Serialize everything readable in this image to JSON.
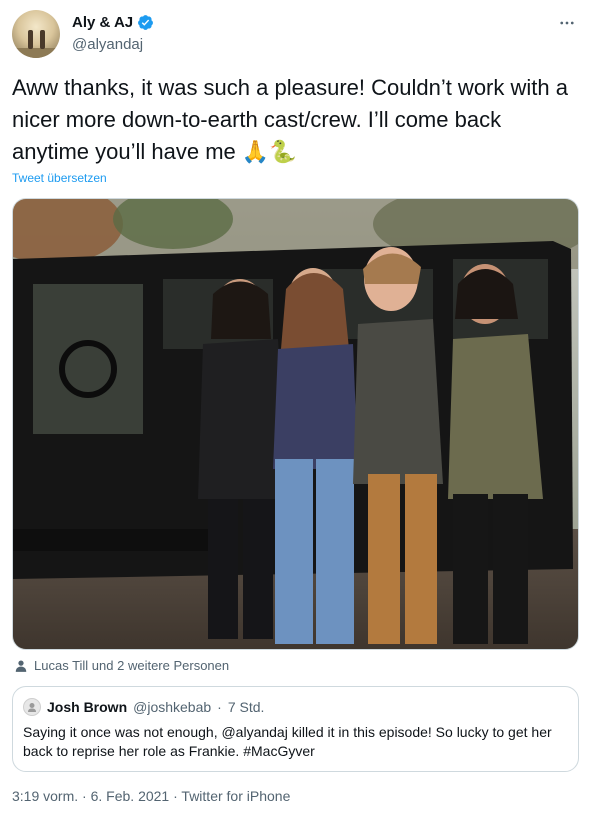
{
  "author": {
    "display_name": "Aly & AJ",
    "handle": "@alyandaj"
  },
  "more_icon": "more-horizontal-icon",
  "tweet": {
    "text": "Aww thanks, it was such a pleasure! Couldn’t work with a nicer more down-to-earth cast/crew. I’ll come back anytime you’ll have me 🙏🐍",
    "translate_label": "Tweet übersetzen"
  },
  "tagged": {
    "label": "Lucas Till und 2 weitere Personen",
    "icon": "person-icon"
  },
  "quoted_tweet": {
    "name": "Josh Brown",
    "handle": "@joshkebab",
    "separator": "·",
    "time": "7 Std.",
    "text": "Saying it once was not enough, @alyandaj killed it in this episode! So lucky to get her back to reprise her role as Frankie. #MacGyver"
  },
  "meta": {
    "time": "3:19 vorm.",
    "separator1": "·",
    "date": "6. Feb. 2021",
    "separator2": "·",
    "source": "Twitter for iPhone"
  },
  "colors": {
    "accent": "#1d9bf0",
    "secondary_text": "#536471",
    "border": "#cfd9de"
  }
}
